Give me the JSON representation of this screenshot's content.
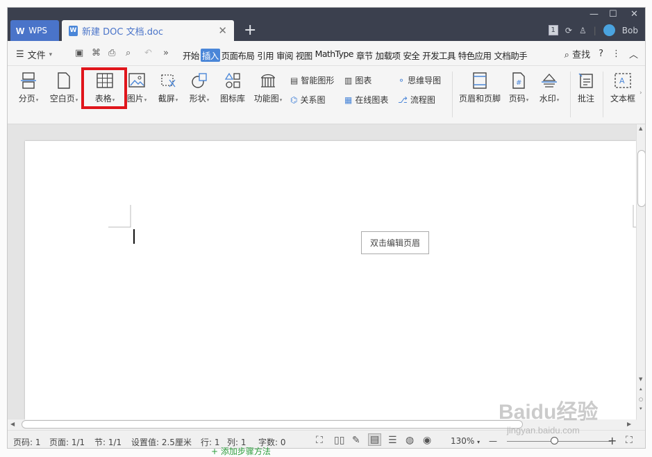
{
  "window": {
    "controls": {
      "minimize": "—",
      "maximize": "☐",
      "close": "✕"
    }
  },
  "tabs": {
    "wps": "WPS",
    "doc": "新建 DOC 文档.doc",
    "new_tab": "+"
  },
  "account": {
    "count": "1",
    "user": "Bob"
  },
  "menu": {
    "file": "文件",
    "items": [
      "开始",
      "插入",
      "页面布局",
      "引用",
      "审阅",
      "视图",
      "MathType",
      "章节",
      "加载项",
      "安全",
      "开发工具",
      "特色应用",
      "文档助手"
    ],
    "active": "插入",
    "search": "查找",
    "help": "?",
    "more": "⋮",
    "collapse": "︿",
    "more_arrows": "»"
  },
  "ribbon": {
    "page_break": "分页",
    "blank_page": "空白页",
    "table": "表格",
    "picture": "图片",
    "screenshot": "截屏",
    "shapes": "形状",
    "icon_lib": "图标库",
    "func_chart": "功能图",
    "smart_shape": "智能图形",
    "chart": "图表",
    "mind_map": "思维导图",
    "relation": "关系图",
    "online_chart": "在线图表",
    "flowchart": "流程图",
    "header_footer": "页眉和页脚",
    "page_number": "页码",
    "watermark": "水印",
    "comment": "批注",
    "textbox": "文本框"
  },
  "document": {
    "header_tip": "双击编辑页眉"
  },
  "status": {
    "page_code": "页码: 1",
    "pages": "页面: 1/1",
    "section": "节: 1/1",
    "setting": "设置值: 2.5厘米",
    "row": "行: 1",
    "col": "列: 1",
    "words": "字数: 0",
    "zoom": "130%",
    "zoom_minus": "—",
    "zoom_plus": "+"
  },
  "watermark": {
    "brand": "Baidu经验",
    "url": "jingyan.baidu.com"
  },
  "page_below": {
    "add_step": "+ 添加步骤方法"
  },
  "colors": {
    "titlebar": "#3b404e",
    "accent": "#4a86d8",
    "highlight": "#e0151b"
  }
}
